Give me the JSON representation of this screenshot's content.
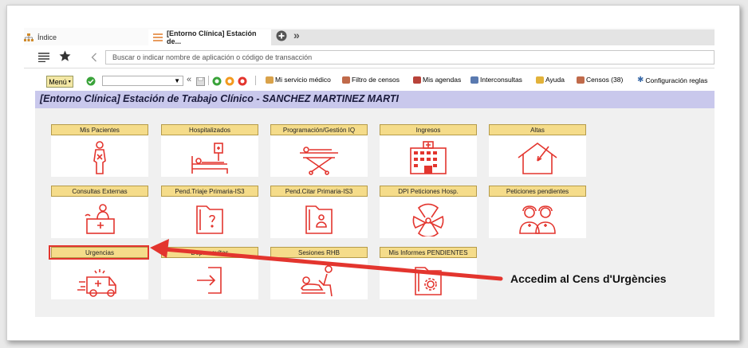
{
  "tabs": [
    {
      "label": "Índice",
      "active": false
    },
    {
      "label": "[Entorno Clínica] Estación de...",
      "active": true
    }
  ],
  "tab_overflow": "»",
  "address_placeholder": "Buscar o indicar nombre de aplicación o código de transacción",
  "toolbar": {
    "menu_label": "Menú",
    "nav_back": "«",
    "items": [
      {
        "label": "Mi servicio médico",
        "icon": "doctor-icon"
      },
      {
        "label": "Filtro de censos",
        "icon": "filter-icon"
      },
      {
        "label": "Mis agendas",
        "icon": "agenda-icon"
      },
      {
        "label": "Interconsultas",
        "icon": "interconsult-icon"
      },
      {
        "label": "Ayuda",
        "icon": "help-icon"
      },
      {
        "label": "Censos (38)",
        "icon": "census-icon"
      },
      {
        "label": "Configuración reglas",
        "icon": "gear-icon"
      }
    ]
  },
  "page_title": "[Entorno Clínica] Estación de Trabajo Clínico - SANCHEZ MARTINEZ MARTI",
  "tiles": [
    {
      "label": "Mis Pacientes",
      "icon": "patient-icon"
    },
    {
      "label": "Hospitalizados",
      "icon": "hospital-bed-icon"
    },
    {
      "label": "Programación/Gestión IQ",
      "icon": "stretcher-icon"
    },
    {
      "label": "Ingresos",
      "icon": "hospital-building-icon"
    },
    {
      "label": "Altas",
      "icon": "house-discharge-icon"
    },
    {
      "label": "Consultas Externas",
      "icon": "reception-desk-icon"
    },
    {
      "label": "Pend.Triaje Primaria-IS3",
      "icon": "question-folder-icon"
    },
    {
      "label": "Pend.Citar Primaria-IS3",
      "icon": "person-folder-icon"
    },
    {
      "label": "DPI Peticiones Hosp.",
      "icon": "radiation-icon"
    },
    {
      "label": "Peticiones pendientes",
      "icon": "nurses-icon"
    },
    {
      "label": "Urgencias",
      "icon": "ambulance-icon"
    },
    {
      "label": "Dep. resultas",
      "icon": "enter-icon"
    },
    {
      "label": "Sesiones RHB",
      "icon": "rehab-icon"
    },
    {
      "label": "Mis Informes PENDIENTES",
      "icon": "report-gear-icon"
    }
  ],
  "callout": "Accedim al Cens d'Urgències",
  "colors": {
    "accent_red": "#e3352e",
    "tile_label_bg": "#f5dc8a",
    "title_band": "#c9c8ec"
  }
}
